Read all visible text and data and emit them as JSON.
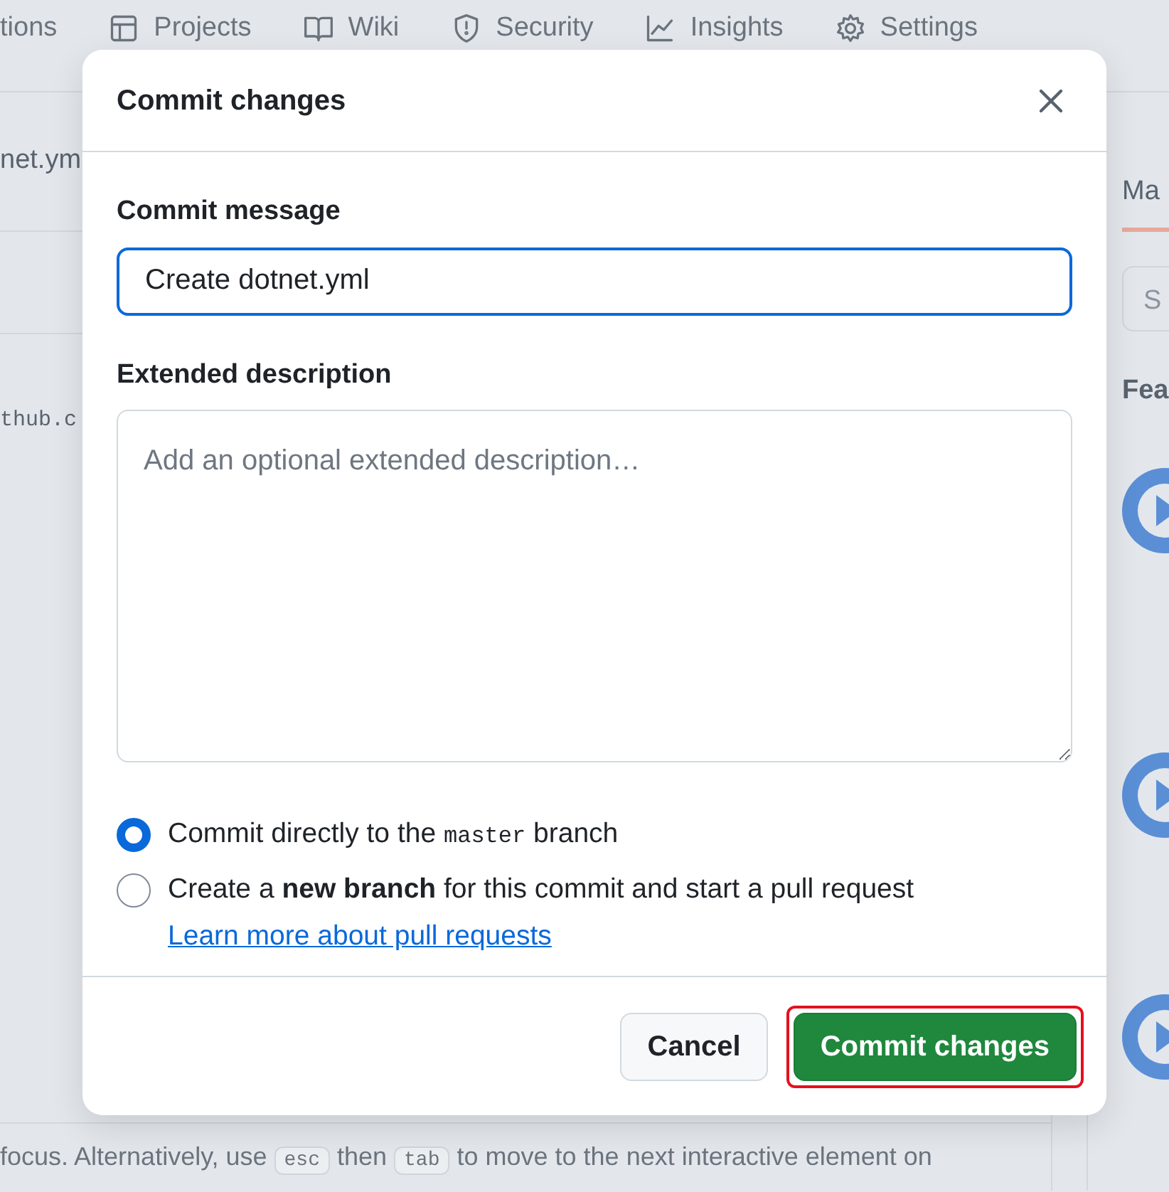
{
  "background": {
    "tabs": [
      {
        "label": "tions"
      },
      {
        "label": "Projects"
      },
      {
        "label": "Wiki"
      },
      {
        "label": "Security"
      },
      {
        "label": "Insights"
      },
      {
        "label": "Settings"
      }
    ],
    "file_name": "net.ym",
    "code_line": "thub.c",
    "sidebar_tab": "Ma",
    "sidebar_search_placeholder": "S",
    "sidebar_heading": "Fea",
    "help_text": [
      {
        "kind": "text",
        "text": "focus. Alternatively, use "
      },
      {
        "kind": "key",
        "text": "esc"
      },
      {
        "kind": "text",
        "text": " then "
      },
      {
        "kind": "key",
        "text": "tab"
      },
      {
        "kind": "text",
        "text": " to move to the next interactive element on"
      }
    ]
  },
  "dialog": {
    "title": "Commit changes",
    "message_label": "Commit message",
    "message_value": "Create dotnet.yml",
    "description_label": "Extended description",
    "description_placeholder": "Add an optional extended description…",
    "options": [
      {
        "selected": true,
        "parts": [
          {
            "kind": "text",
            "text": "Commit directly to the "
          },
          {
            "kind": "code",
            "text": "master"
          },
          {
            "kind": "text",
            "text": " branch"
          }
        ]
      },
      {
        "selected": false,
        "parts": [
          {
            "kind": "text",
            "text": "Create a **new branch** for this commit and start a pull request"
          }
        ],
        "link": "Learn more about pull requests"
      }
    ],
    "buttons": [
      {
        "kind": "secondary",
        "label": "Cancel",
        "highlighted": false
      },
      {
        "kind": "primary",
        "label": "Commit changes",
        "highlighted": true
      }
    ]
  }
}
